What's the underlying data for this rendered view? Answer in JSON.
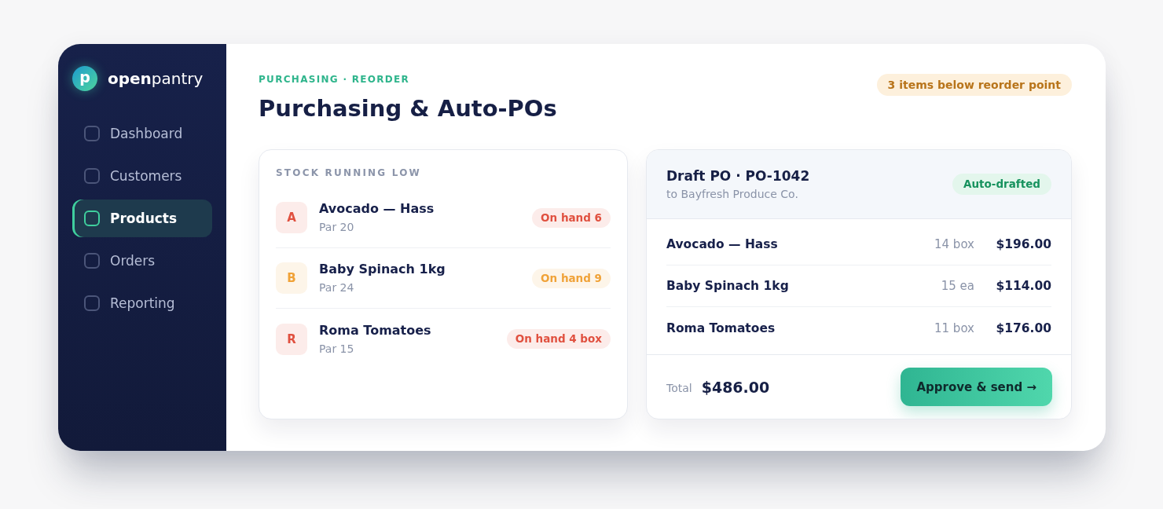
{
  "sidebar": {
    "logo": {
      "letter": "p",
      "name": "**open**pantry"
    },
    "items": [
      {
        "label": "Dashboard",
        "selected": false
      },
      {
        "label": "Customers",
        "selected": false
      },
      {
        "label": "Products",
        "selected": true
      },
      {
        "label": "Orders",
        "selected": false
      },
      {
        "label": "Reporting",
        "selected": false
      }
    ]
  },
  "header": {
    "eyebrow": "PURCHASING · REORDER",
    "title": "Purchasing & Auto-POs",
    "alert_badge": "3 items below reorder point"
  },
  "low_stock": {
    "title": "STOCK RUNNING LOW",
    "items": [
      {
        "initial": "A",
        "name": "Avocado — Hass",
        "par": "Par 20",
        "on_hand": "On hand 6",
        "color": "#e0503f"
      },
      {
        "initial": "B",
        "name": "Baby Spinach 1kg",
        "par": "Par 24",
        "on_hand": "On hand 9",
        "color": "#f0a238"
      },
      {
        "initial": "R",
        "name": "Roma Tomatoes",
        "par": "Par 15",
        "on_hand": "On hand 4 box",
        "color": "#e0503f"
      }
    ]
  },
  "draft_po": {
    "title": "Draft PO · PO-1042",
    "supplier": "to Bayfresh Produce Co.",
    "status": "Auto-drafted",
    "lines": [
      {
        "name": "Avocado — Hass",
        "qty": "14 box",
        "amount": "$196.00"
      },
      {
        "name": "Baby Spinach 1kg",
        "qty": "15 ea",
        "amount": "$114.00"
      },
      {
        "name": "Roma Tomatoes",
        "qty": "11 box",
        "amount": "$176.00"
      }
    ],
    "total_label": "Total",
    "total": "$486.00",
    "action": "Approve & send →"
  }
}
